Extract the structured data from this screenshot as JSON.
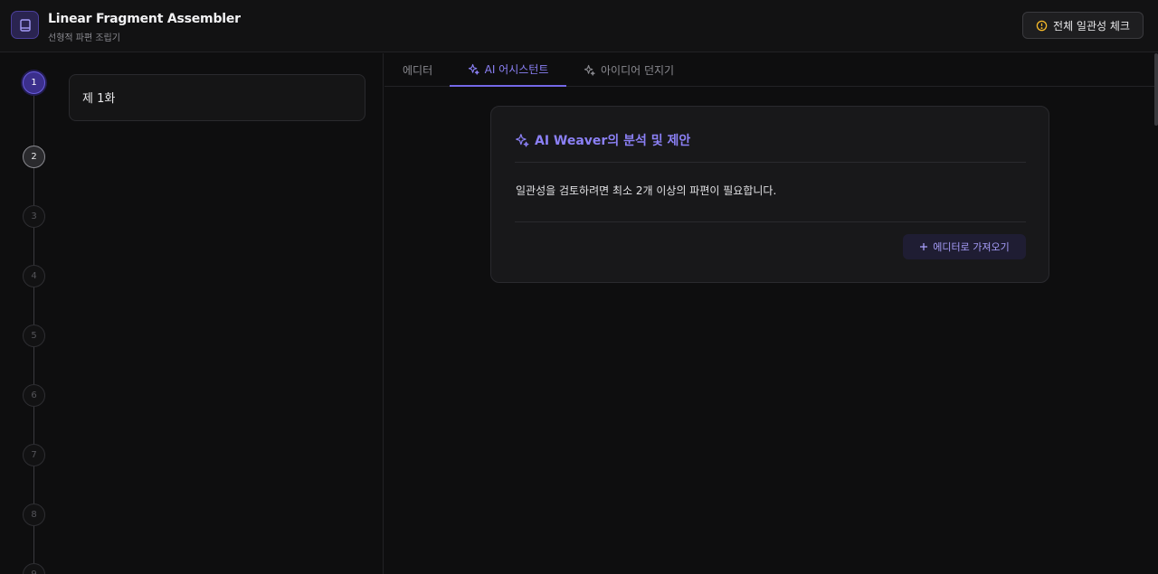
{
  "header": {
    "app_title": "Linear Fragment Assembler",
    "app_subtitle": "선형적 파편 조립기",
    "logo_icon": "book-icon",
    "check_button_label": "전체 일관성 체크",
    "check_button_icon": "alert-circle-icon"
  },
  "timeline": {
    "nodes": [
      "1",
      "2",
      "3",
      "4",
      "5",
      "6",
      "7",
      "8",
      "9"
    ],
    "active_node": "1"
  },
  "fragments": [
    {
      "title": "제 1화"
    }
  ],
  "tabs": [
    {
      "label": "에디터",
      "active": false
    },
    {
      "label": "AI 어시스턴트",
      "icon": "sparkles-icon",
      "active": true
    },
    {
      "label": "아이디어 던지기",
      "icon": "sparkles-icon",
      "active": false
    }
  ],
  "ai_panel": {
    "title": "AI Weaver의 분석 및 제안",
    "title_icon": "sparkles-icon",
    "message": "일관성을 검토하려면 최소 2개 이상의 파편이 필요합니다.",
    "import_button_label": "에디터로 가져오기",
    "import_button_icon": "plus-icon"
  },
  "colors": {
    "background": "#0e0e0f",
    "accent": "#8b80f5",
    "active_node": "#3b2f8c",
    "warning": "#f5b829"
  }
}
